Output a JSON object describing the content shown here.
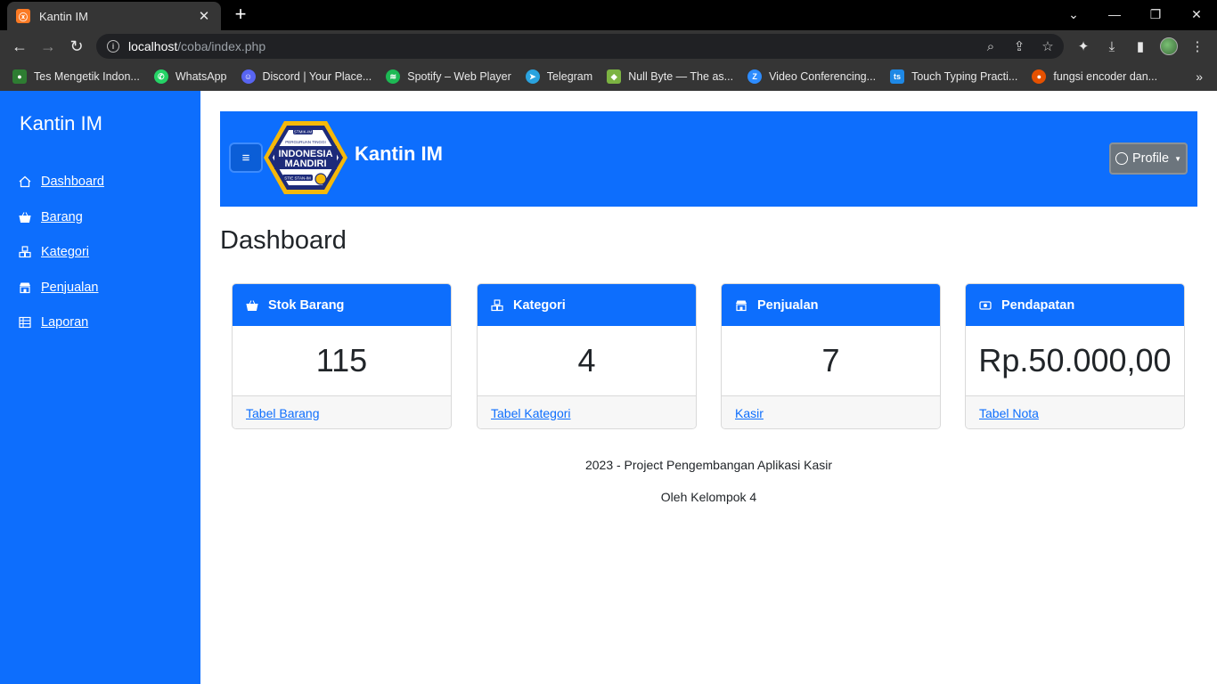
{
  "browser": {
    "tab_title": "Kantin IM",
    "tab_favicon": "XAMPP",
    "url_host": "localhost",
    "url_path": "/coba/index.php",
    "bookmarks": [
      {
        "label": "Tes Mengetik Indon...",
        "color": "#2e7d32"
      },
      {
        "label": "WhatsApp",
        "color": "#25d366"
      },
      {
        "label": "Discord | Your Place...",
        "color": "#5865f2"
      },
      {
        "label": "Spotify – Web Player",
        "color": "#1db954"
      },
      {
        "label": "Telegram",
        "color": "#2aa3df"
      },
      {
        "label": "Null Byte — The as...",
        "color": "#7cb342"
      },
      {
        "label": "Video Conferencing...",
        "color": "#2d8cff"
      },
      {
        "label": "Touch Typing Practi...",
        "color": "#1e88e5"
      },
      {
        "label": "fungsi encoder dan...",
        "color": "#e65100"
      }
    ]
  },
  "sidebar": {
    "brand": "Kantin IM",
    "items": [
      {
        "label": " Dashboard",
        "icon": "home-icon"
      },
      {
        "label": " Barang",
        "icon": "basket-icon"
      },
      {
        "label": " Kategori",
        "icon": "boxes-icon"
      },
      {
        "label": " Penjualan",
        "icon": "shop-icon"
      },
      {
        "label": " Laporan",
        "icon": "table-icon"
      }
    ]
  },
  "header": {
    "title": "Kantin IM",
    "profile_label": "Profile",
    "logo_text_top": "STMIK-IM",
    "logo_text_mid": "PERGURUAN TINGGI",
    "logo_text_1": "INDONESIA",
    "logo_text_2": "MANDIRI",
    "logo_text_bottom": "STIE STAN-IM"
  },
  "main": {
    "page_title": "Dashboard",
    "cards": [
      {
        "title": "Stok Barang",
        "value": "115",
        "link": "Tabel Barang",
        "icon": "basket-icon"
      },
      {
        "title": "Kategori",
        "value": "4",
        "link": "Tabel Kategori",
        "icon": "boxes-icon"
      },
      {
        "title": "Penjualan",
        "value": "7",
        "link": "Kasir",
        "icon": "shop-icon"
      },
      {
        "title": "Pendapatan",
        "value": "Rp.50.000,00",
        "link": "Tabel Nota",
        "icon": "cash-icon"
      }
    ]
  },
  "footer": {
    "line1": "2023 - Project Pengembangan Aplikasi Kasir",
    "line2": "Oleh Kelompok 4"
  },
  "colors": {
    "primary": "#0d6efd",
    "secondary": "#6c757d"
  }
}
